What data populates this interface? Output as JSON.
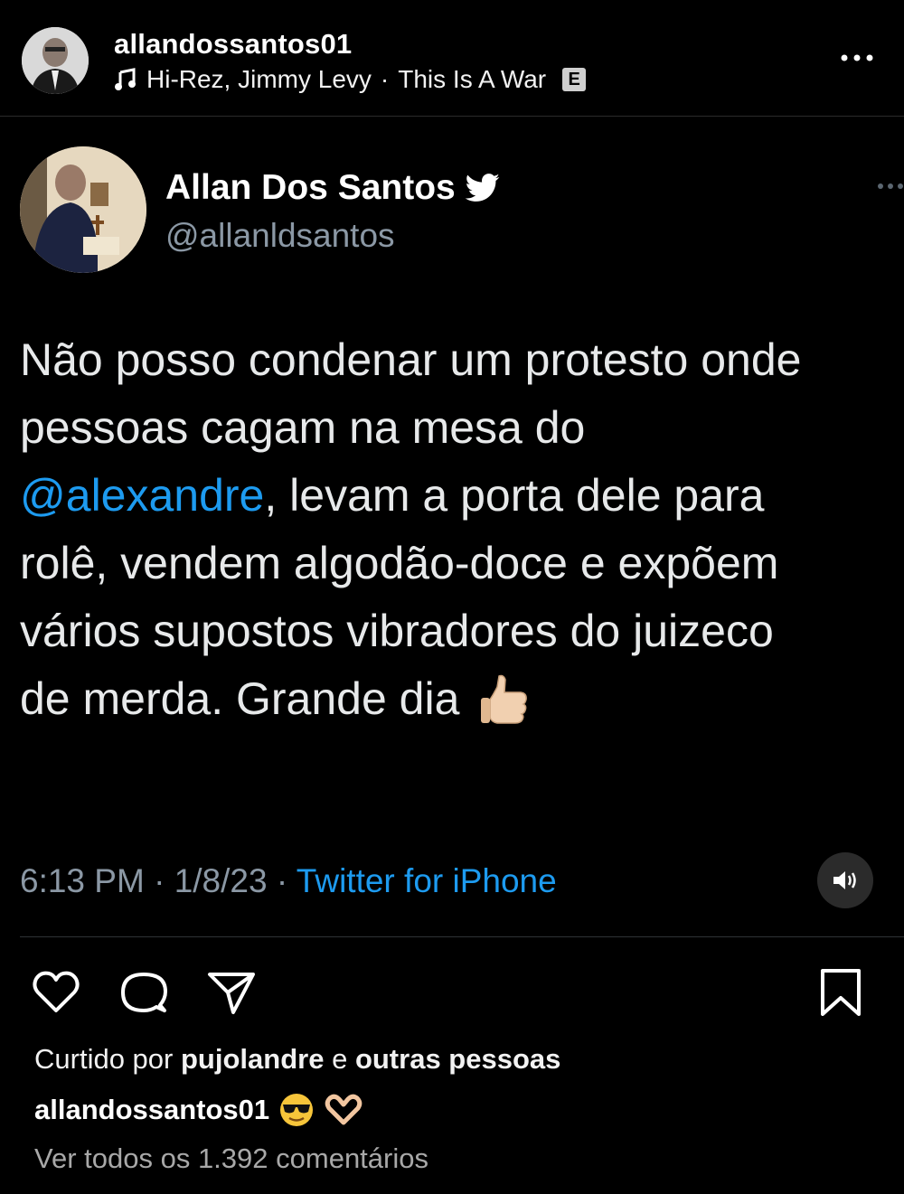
{
  "header": {
    "username": "allandossantos01",
    "music_artist": "Hi-Rez, Jimmy Levy",
    "music_separator": "·",
    "music_title": "This Is A War",
    "explicit_badge": "E"
  },
  "tweet": {
    "display_name": "Allan Dos Santos",
    "handle": "@allanldsantos",
    "text_parts": [
      "Não posso condenar um protesto onde",
      "pessoas cagam na mesa do",
      "@alexandre",
      ", levam a porta dele para",
      "rolê, vendem algodão-doce e expõem",
      "vários supostos vibradores do juizeco",
      "de merda. Grande dia"
    ],
    "time": "6:13 PM",
    "date": "1/8/23",
    "separator": "·",
    "source": "Twitter for iPhone"
  },
  "post": {
    "liked_prefix": "Curtido por",
    "liked_user": "pujolandre",
    "liked_conj": "e",
    "liked_others": "outras pessoas",
    "caption_user": "allandossantos01",
    "view_comments": "Ver todos os 1.392 comentários"
  },
  "colors": {
    "background": "#000000",
    "twitter_blue": "#1d9bf0",
    "muted": "#8b98a5"
  },
  "icons": [
    "music-note-icon",
    "more-icon",
    "verified-bird-icon",
    "thumbs-up-emoji",
    "sound-icon",
    "heart-icon",
    "comment-icon",
    "share-icon",
    "bookmark-icon",
    "sunglasses-emoji",
    "heart-hands-emoji"
  ]
}
